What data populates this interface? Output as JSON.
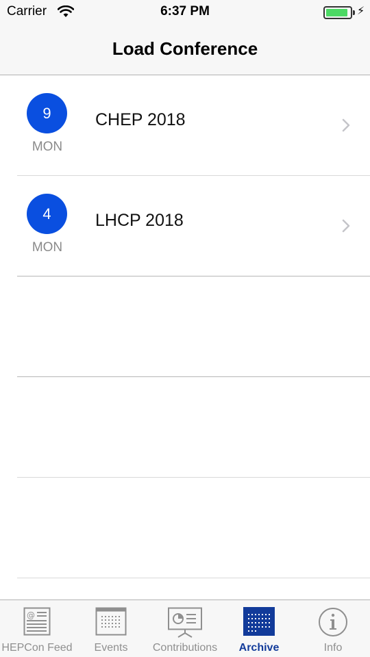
{
  "status_bar": {
    "carrier": "Carrier",
    "time": "6:37 PM",
    "battery_level": 0.9,
    "charging": true
  },
  "nav": {
    "title": "Load Conference"
  },
  "conferences": [
    {
      "day": "9",
      "weekday": "MON",
      "name": "CHEP 2018"
    },
    {
      "day": "4",
      "weekday": "MON",
      "name": "LHCP 2018"
    }
  ],
  "tabs": [
    {
      "label": "HEPCon Feed",
      "icon": "newspaper-icon",
      "active": false
    },
    {
      "label": "Events",
      "icon": "calendar-icon",
      "active": false
    },
    {
      "label": "Contributions",
      "icon": "presentation-icon",
      "active": false
    },
    {
      "label": "Archive",
      "icon": "archive-calendar-icon",
      "active": true
    },
    {
      "label": "Info",
      "icon": "info-icon",
      "active": false
    }
  ],
  "colors": {
    "accent": "#0a4fe0",
    "active_tab": "#123b9a",
    "inactive_tab": "#8f8f8f",
    "battery": "#4cd964"
  }
}
